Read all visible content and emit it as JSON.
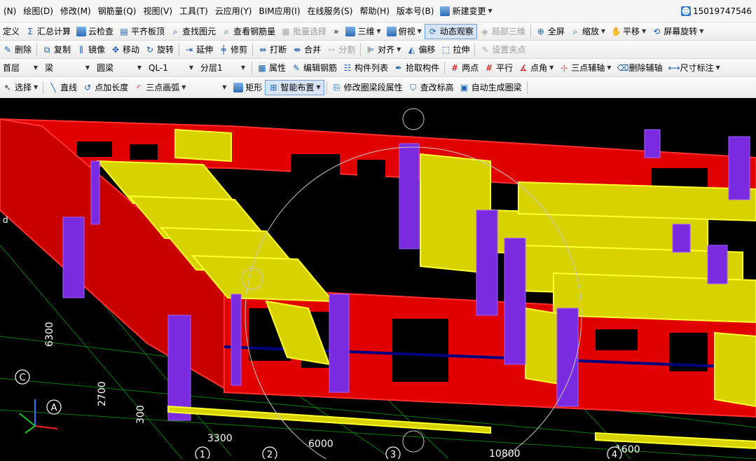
{
  "menu": [
    "(N)",
    "绘图(D)",
    "修改(M)",
    "钢筋量(Q)",
    "视图(V)",
    "工具(T)",
    "云应用(Y)",
    "BIM应用(I)",
    "在线服务(S)",
    "帮助(H)",
    "版本号(B)"
  ],
  "menu_change": "新建变更",
  "user_phone": "15019747546",
  "row1": {
    "define": "定义",
    "sum_calc": "汇总计算",
    "cloud_check": "云检查",
    "flush_slab": "平齐板顶",
    "find_element": "查找图元",
    "view_rebar": "查看钢筋量",
    "batch_select": "批量选择",
    "three_d": "三维",
    "top_view": "俯视",
    "dynamic_orbit": "动态观察",
    "partial_3d": "局部三维",
    "fullscreen": "全屏",
    "zoom": "缩放",
    "pan": "平移",
    "screen_rotate": "屏幕旋转"
  },
  "row2": {
    "delete": "删除",
    "copy": "复制",
    "mirror": "镜像",
    "move": "移动",
    "rotate": "旋转",
    "extend": "延伸",
    "trim": "修剪",
    "break": "打断",
    "merge": "合并",
    "split": "分割",
    "align": "对齐",
    "offset": "偏移",
    "stretch": "拉伸",
    "set_grip": "设置夹点"
  },
  "row3": {
    "floor": "首层",
    "category": "梁",
    "type": "圆梁",
    "element": "QL-1",
    "layer": "分层1",
    "attributes": "属性",
    "edit_rebar": "编辑钢筋",
    "member_list": "构件列表",
    "pick_member": "拾取构件",
    "two_points": "两点",
    "parallel": "平行",
    "point_angle": "点角",
    "three_point_axis": "三点辅轴",
    "delete_axis": "删除辅轴",
    "dimension": "尺寸标注"
  },
  "row4": {
    "select": "选择",
    "line": "直线",
    "point_length": "点加长度",
    "three_point_arc": "三点画弧",
    "rectangle": "矩形",
    "smart_layout": "智能布置",
    "modify_segment": "修改圈梁段属性",
    "change_elevation": "查改标高",
    "auto_ring_beam": "自动生成圈梁"
  },
  "viewport": {
    "grid_letters": [
      "C",
      "A"
    ],
    "grid_numbers": [
      "1",
      "2",
      "3",
      "4"
    ],
    "dims_vertical": [
      "6300",
      "2700",
      "300"
    ],
    "dims_horizontal": [
      "3300",
      "6000",
      "10800",
      "1600"
    ],
    "partial_letter": "d"
  },
  "colors": {
    "wall": "#e00000",
    "wall_top": "#ff3030",
    "column": "#7a2be0",
    "column_light": "#a060ff",
    "panel": "#d8d200",
    "panel_edge": "#ffff30",
    "beam": "#000080",
    "grid": "#0a7a0a",
    "background": "#000000"
  }
}
